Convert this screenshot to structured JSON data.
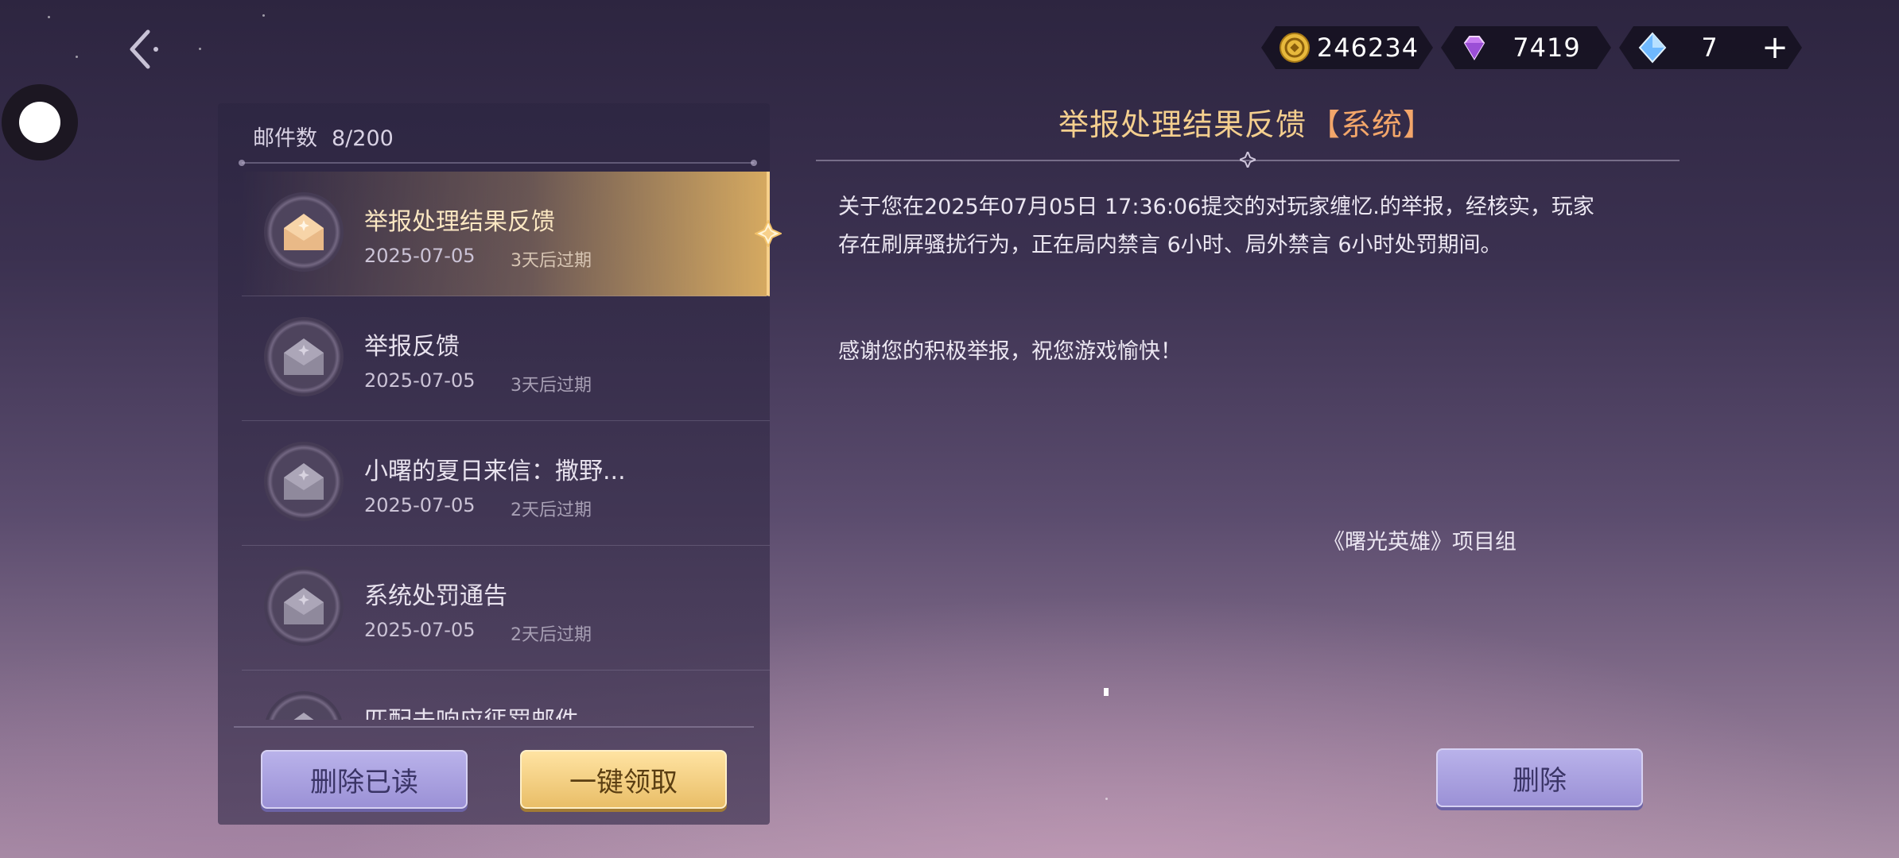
{
  "header": {
    "currencies": [
      {
        "icon": "gold-coin-icon",
        "value": "246234"
      },
      {
        "icon": "purple-diamond-icon",
        "value": "7419"
      },
      {
        "icon": "blue-crystal-icon",
        "value": "7"
      }
    ],
    "add_label": "+"
  },
  "mailbox": {
    "count_label": "邮件数",
    "count_value": "8/200",
    "items": [
      {
        "title": "举报处理结果反馈",
        "date": "2025-07-05",
        "expire": "3天后过期"
      },
      {
        "title": "举报反馈",
        "date": "2025-07-05",
        "expire": "3天后过期"
      },
      {
        "title": "小曙的夏日来信：撒野...",
        "date": "2025-07-05",
        "expire": "2天后过期"
      },
      {
        "title": "系统处罚通告",
        "date": "2025-07-05",
        "expire": "2天后过期"
      },
      {
        "title": "匹配未响应惩罚邮件",
        "date": "",
        "expire": ""
      }
    ],
    "delete_read_label": "删除已读",
    "claim_all_label": "一键领取"
  },
  "detail": {
    "title": "举报处理结果反馈",
    "tag": "【系统】",
    "body_line1": "关于您在2025年07月05日 17:36:06提交的对玩家缠忆.的举报，经核实，玩家",
    "body_line2": "存在刷屏骚扰行为，正在局内禁言 6小时、局外禁言 6小时处罚期间。",
    "body_line3": "感谢您的积极举报，祝您游戏愉快！",
    "signature": "《曙光英雄》项目组",
    "delete_label": "删除"
  }
}
